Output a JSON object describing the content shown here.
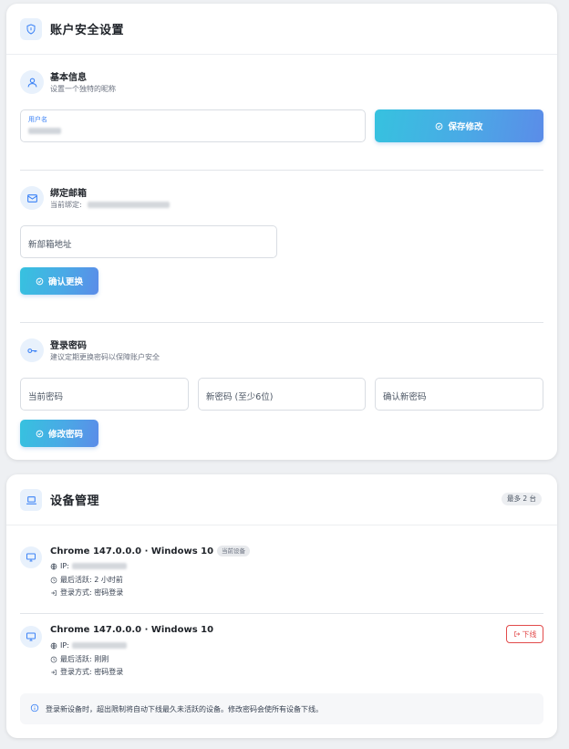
{
  "account": {
    "title": "账户安全设置",
    "basic": {
      "title": "基本信息",
      "subtitle": "设置一个独特的昵称",
      "username_label": "用户名",
      "save_label": "保存修改"
    },
    "email": {
      "title": "绑定邮箱",
      "current_prefix": "当前绑定:",
      "new_placeholder": "新部箱地址",
      "confirm_label": "确认更换"
    },
    "password": {
      "title": "登录密码",
      "subtitle": "建议定期更换密码以保障账户安全",
      "current_placeholder": "当前密码",
      "new_placeholder": "新密码 (至少6位)",
      "confirm_placeholder": "确认新密码",
      "change_label": "修改密码"
    }
  },
  "devices": {
    "title": "设备管理",
    "max_badge": "最多 2 台",
    "items": [
      {
        "name": "Chrome 147.0.0.0 · Windows 10",
        "current_badge": "当前设备",
        "ip_prefix": "IP:",
        "last_active": "最后活跃: 2 小时前",
        "login_method": "登录方式: 密码登录"
      },
      {
        "name": "Chrome 147.0.0.0 · Windows 10",
        "ip_prefix": "IP:",
        "last_active": "最后活跃: 刚刚",
        "login_method": "登录方式: 密码登录",
        "logout_label": "下线"
      }
    ],
    "notice": "登录新设备时，超出限制将自动下线最久未活跃的设备。修改密码会使所有设备下线。"
  },
  "colors": {
    "accent": "#3b82f6",
    "gradient_start": "#36c2df",
    "gradient_end": "#5b8ce8",
    "danger": "#e24b4b"
  },
  "icons": [
    "shield-icon",
    "user-icon",
    "mail-icon",
    "key-icon",
    "check-circle-icon",
    "laptop-icon",
    "monitor-icon",
    "globe-icon",
    "clock-icon",
    "login-icon",
    "logout-icon",
    "info-icon"
  ]
}
